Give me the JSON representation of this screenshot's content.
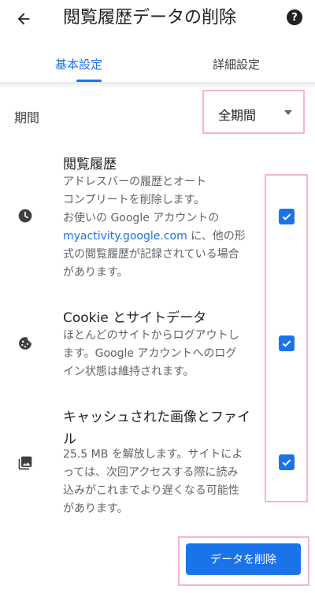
{
  "appbar": {
    "title": "閲覧履歴データの削除",
    "back_icon": "arrow-left-icon",
    "help_icon": "help-icon",
    "help_glyph": "?"
  },
  "tabs": [
    {
      "label": "基本設定",
      "selected": true
    },
    {
      "label": "詳細設定",
      "selected": false
    }
  ],
  "time_range": {
    "label": "期間",
    "value": "全期間"
  },
  "items": [
    {
      "title": "閲覧履歴",
      "icon": "clock-icon",
      "checked": true,
      "desc_1": "アドレスバーの履歴とオート",
      "desc_2": "コンプリートを削除します。",
      "desc_3": "お使いの Google アカウントの",
      "desc_link": "myactivity.google.com",
      "desc_4": " に、他の形",
      "desc_5": "式の閲覧履歴が記録されている場合",
      "desc_6": "があります。"
    },
    {
      "title": "Cookie とサイトデータ",
      "icon": "cookie-icon",
      "checked": true,
      "desc_1": "ほとんどのサイトからログアウトし",
      "desc_2": "ます。Google アカウントへのログ",
      "desc_3": "イン状態は維持されます。"
    },
    {
      "title_1": "キャッシュされた画像とファイ",
      "title_2": "ル",
      "icon": "image-icon",
      "checked": true,
      "desc_1": "25.5 MB を解放します。サイトによ",
      "desc_2": "っては、次回アクセスする際に読み",
      "desc_3": "込みがこれまでより遅くなる可能性",
      "desc_4": "があります。"
    }
  ],
  "actions": {
    "clear_label": "データを削除"
  },
  "colors": {
    "accent": "#1a73e8",
    "highlight_frame": "#f2b6cf"
  }
}
